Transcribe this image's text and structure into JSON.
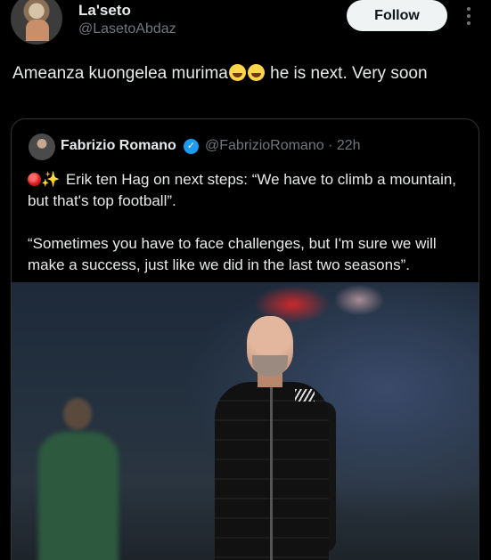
{
  "tweet": {
    "author": {
      "display_name": "La'seto",
      "handle": "@LasetoAbdaz"
    },
    "follow_label": "Follow",
    "text_before_emoji": "Ameanza kuongelea murima",
    "text_after_emoji": " he is next. Very soon",
    "emojis": [
      "grinning-sweat-emoji",
      "grinning-sweat-emoji"
    ]
  },
  "quoted_tweet": {
    "author": {
      "display_name": "Fabrizio Romano",
      "handle": "@FabrizioRomano",
      "time": "· 22h",
      "verified": true
    },
    "line1": " Erik ten Hag on next steps: “We have to climb a mountain, but that's top football”.",
    "line2": "“Sometimes you have to face challenges, but I'm sure we will make a success, just like we did in the last two seasons”.",
    "leading_icons": [
      "red-circle-icon",
      "sparkles-icon"
    ],
    "media": "photo"
  },
  "colors": {
    "background": "#000000",
    "primary_text": "#e7e9ea",
    "secondary_text": "#71767b",
    "verified_blue": "#1d9bf0",
    "border": "#2f3336"
  }
}
